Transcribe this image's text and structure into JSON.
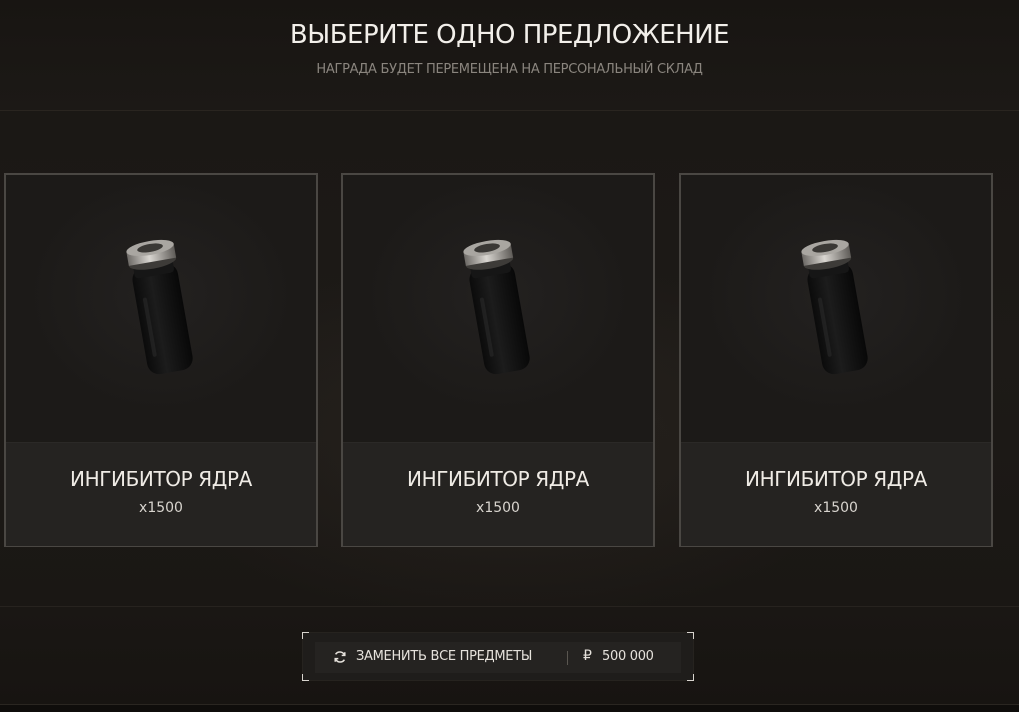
{
  "header": {
    "title": "ВЫБЕРИТЕ ОДНО ПРЕДЛОЖЕНИЕ",
    "subtitle": "НАГРАДА БУДЕТ ПЕРЕМЕЩЕНА НА ПЕРСОНАЛЬНЫЙ СКЛАД"
  },
  "offers": [
    {
      "name": "ИНГИБИТОР ЯДРА",
      "quantity": "x1500",
      "icon": "vial-icon"
    },
    {
      "name": "ИНГИБИТОР ЯДРА",
      "quantity": "x1500",
      "icon": "vial-icon"
    },
    {
      "name": "ИНГИБИТОР ЯДРА",
      "quantity": "x1500",
      "icon": "vial-icon"
    }
  ],
  "reroll": {
    "label": "ЗАМЕНИТЬ ВСЕ ПРЕДМЕТЫ",
    "icon": "refresh-icon",
    "currency_symbol": "₽",
    "currency_icon": "ruble-icon",
    "price": "500 000"
  }
}
